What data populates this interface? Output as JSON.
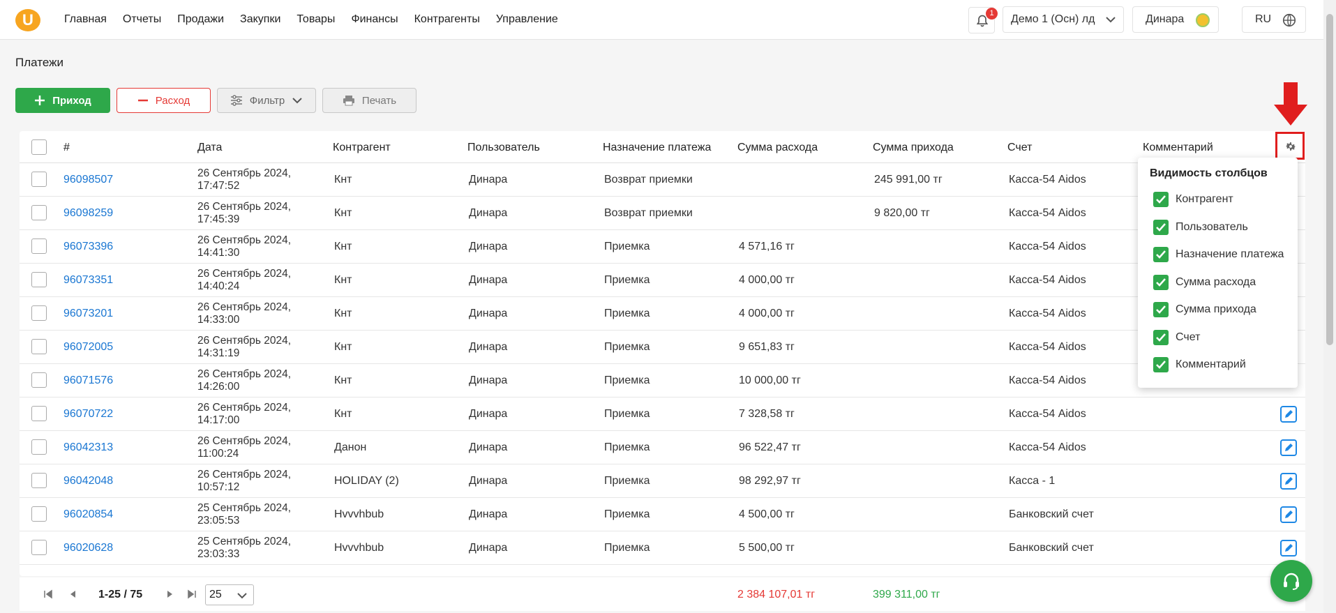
{
  "nav": {
    "logo_letter": "U",
    "items": [
      "Главная",
      "Отчеты",
      "Продажи",
      "Закупки",
      "Товары",
      "Финансы",
      "Контрагенты",
      "Управление"
    ]
  },
  "header": {
    "notification_count": "1",
    "company": "Демо 1 (Осн) лд",
    "user": "Динара",
    "lang": "RU"
  },
  "page": {
    "title": "Платежи"
  },
  "toolbar": {
    "income_label": "Приход",
    "expense_label": "Расход",
    "filter_label": "Фильтр",
    "print_label": "Печать"
  },
  "table": {
    "columns": [
      "#",
      "Дата",
      "Контрагент",
      "Пользователь",
      "Назначение платежа",
      "Сумма расхода",
      "Сумма прихода",
      "Счет",
      "Комментарий"
    ],
    "rows": [
      {
        "id": "96098507",
        "date1": "26 Сентябрь 2024,",
        "date2": "17:47:52",
        "party": "Кнт",
        "user": "Динара",
        "purpose": "Возврат приемки",
        "out": "",
        "in": "245 991,00 тг",
        "account": "Касса-54 Aidos",
        "edit": false
      },
      {
        "id": "96098259",
        "date1": "26 Сентябрь 2024,",
        "date2": "17:45:39",
        "party": "Кнт",
        "user": "Динара",
        "purpose": "Возврат приемки",
        "out": "",
        "in": "9 820,00 тг",
        "account": "Касса-54 Aidos",
        "edit": false
      },
      {
        "id": "96073396",
        "date1": "26 Сентябрь 2024,",
        "date2": "14:41:30",
        "party": "Кнт",
        "user": "Динара",
        "purpose": "Приемка",
        "out": "4 571,16 тг",
        "in": "",
        "account": "Касса-54 Aidos",
        "edit": false
      },
      {
        "id": "96073351",
        "date1": "26 Сентябрь 2024,",
        "date2": "14:40:24",
        "party": "Кнт",
        "user": "Динара",
        "purpose": "Приемка",
        "out": "4 000,00 тг",
        "in": "",
        "account": "Касса-54 Aidos",
        "edit": false
      },
      {
        "id": "96073201",
        "date1": "26 Сентябрь 2024,",
        "date2": "14:33:00",
        "party": "Кнт",
        "user": "Динара",
        "purpose": "Приемка",
        "out": "4 000,00 тг",
        "in": "",
        "account": "Касса-54 Aidos",
        "edit": false
      },
      {
        "id": "96072005",
        "date1": "26 Сентябрь 2024,",
        "date2": "14:31:19",
        "party": "Кнт",
        "user": "Динара",
        "purpose": "Приемка",
        "out": "9 651,83 тг",
        "in": "",
        "account": "Касса-54 Aidos",
        "edit": false
      },
      {
        "id": "96071576",
        "date1": "26 Сентябрь 2024,",
        "date2": "14:26:00",
        "party": "Кнт",
        "user": "Динара",
        "purpose": "Приемка",
        "out": "10 000,00 тг",
        "in": "",
        "account": "Касса-54 Aidos",
        "edit": false
      },
      {
        "id": "96070722",
        "date1": "26 Сентябрь 2024,",
        "date2": "14:17:00",
        "party": "Кнт",
        "user": "Динара",
        "purpose": "Приемка",
        "out": "7 328,58 тг",
        "in": "",
        "account": "Касса-54 Aidos",
        "edit": true
      },
      {
        "id": "96042313",
        "date1": "26 Сентябрь 2024,",
        "date2": "11:00:24",
        "party": "Данон",
        "user": "Динара",
        "purpose": "Приемка",
        "out": "96 522,47 тг",
        "in": "",
        "account": "Касса-54 Aidos",
        "edit": true
      },
      {
        "id": "96042048",
        "date1": "26 Сентябрь 2024,",
        "date2": "10:57:12",
        "party": "HOLIDAY (2)",
        "user": "Динара",
        "purpose": "Приемка",
        "out": "98 292,97 тг",
        "in": "",
        "account": "Касса - 1",
        "edit": true
      },
      {
        "id": "96020854",
        "date1": "25 Сентябрь 2024,",
        "date2": "23:05:53",
        "party": "Hvvvhbub",
        "user": "Динара",
        "purpose": "Приемка",
        "out": "4 500,00 тг",
        "in": "",
        "account": "Банковский счет",
        "edit": true
      },
      {
        "id": "96020628",
        "date1": "25 Сентябрь 2024,",
        "date2": "23:03:33",
        "party": "Hvvvhbub",
        "user": "Динара",
        "purpose": "Приемка",
        "out": "5 500,00 тг",
        "in": "",
        "account": "Банковский счет",
        "edit": true
      }
    ]
  },
  "column_menu": {
    "title": "Видимость столбцов",
    "items": [
      "Контрагент",
      "Пользователь",
      "Назначение платежа",
      "Сумма расхода",
      "Сумма прихода",
      "Счет",
      "Комментарий"
    ]
  },
  "footer": {
    "range": "1-25 / 75",
    "page_size": "25",
    "total_out": "2 384 107,01 тг",
    "total_in": "399 311,00 тг"
  },
  "colors": {
    "green": "#2ea84a",
    "red": "#e53935",
    "blue": "#1976d2"
  }
}
